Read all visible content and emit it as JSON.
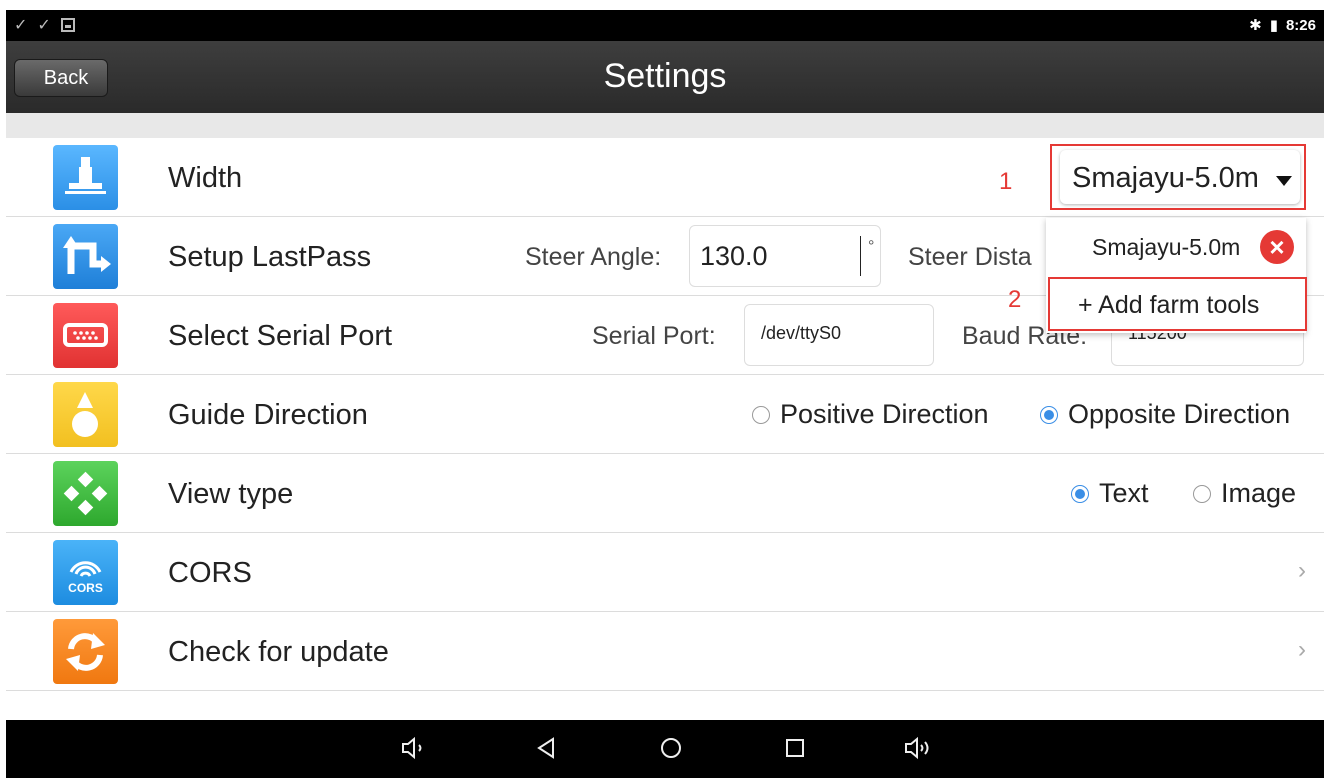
{
  "status_bar": {
    "time": "8:26"
  },
  "header": {
    "back_label": "Back",
    "title": "Settings"
  },
  "rows": {
    "width": {
      "label": "Width",
      "selected": "Smajayu-5.0m",
      "marker": "1"
    },
    "lastpass": {
      "label": "Setup LastPass",
      "steer_angle_label": "Steer Angle:",
      "steer_angle_value": "130.0",
      "unit": "°",
      "steer_distance_label": "Steer Dista"
    },
    "serial": {
      "label": "Select Serial Port",
      "port_label": "Serial Port:",
      "port_value": "/dev/ttyS0",
      "baud_label": "Baud Rate:",
      "baud_value": "115200"
    },
    "guide": {
      "label": "Guide Direction",
      "options": [
        "Positive Direction",
        "Opposite Direction"
      ],
      "selected": "Opposite Direction"
    },
    "view": {
      "label": "View type",
      "options": [
        "Text",
        "Image"
      ],
      "selected": "Text"
    },
    "cors": {
      "label": "CORS",
      "icon_text": "CORS"
    },
    "update": {
      "label": "Check for update"
    }
  },
  "dropdown": {
    "item": "Smajayu-5.0m",
    "add_label": "+ Add farm tools",
    "marker": "2"
  },
  "accent_colors": {
    "highlight": "#e53935",
    "radio": "#3a8ee6"
  }
}
